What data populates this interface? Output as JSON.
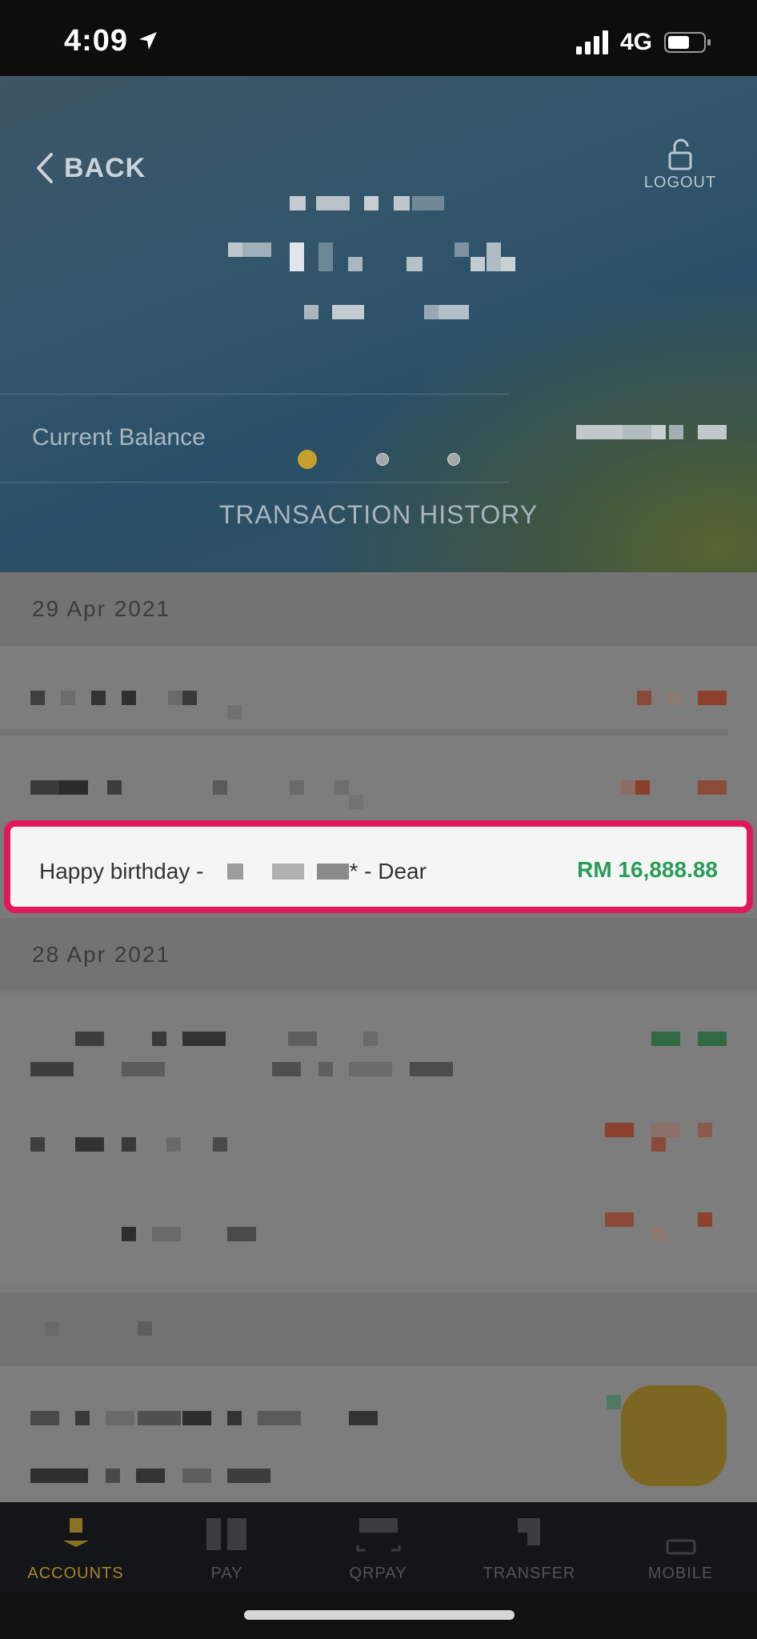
{
  "status_bar": {
    "time": "4:09",
    "network": "4G"
  },
  "header": {
    "back_label": "BACK",
    "logout_label": "LOGOUT",
    "balance_label": "Current Balance",
    "section_title": "TRANSACTION HISTORY"
  },
  "groups": [
    {
      "date": "29 Apr 2021"
    },
    {
      "date": "28 Apr 2021"
    }
  ],
  "highlighted_transaction": {
    "desc_prefix": "Happy birthday -",
    "desc_suffix": "* - Dear",
    "amount": "RM 16,888.88"
  },
  "tabs": [
    {
      "label": "ACCOUNTS",
      "icon": "accounts-icon",
      "active": true
    },
    {
      "label": "PAY",
      "icon": "pay-icon",
      "active": false
    },
    {
      "label": "QRPAY",
      "icon": "qr-icon",
      "active": false
    },
    {
      "label": "TRANSFER",
      "icon": "transfer-icon",
      "active": false
    },
    {
      "label": "MOBILE",
      "icon": "mobile-icon",
      "active": false
    }
  ],
  "colors": {
    "highlight_border": "#e0195a",
    "amount_positive": "#2a9c5a",
    "tab_active": "#b08f2a",
    "tab_inactive": "#555a60"
  }
}
